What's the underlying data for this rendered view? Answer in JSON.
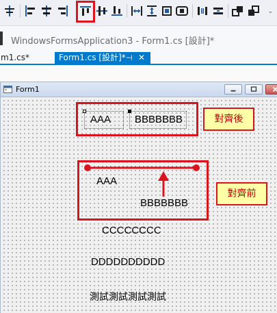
{
  "toolbar": {
    "icons": [
      "align-to-grid-icon",
      "align-lefts-icon",
      "align-centers-icon",
      "align-rights-icon",
      "align-tops-icon",
      "align-middles-icon",
      "align-bottoms-icon",
      "make-same-width-icon",
      "make-same-height-icon",
      "size-to-grid-icon",
      "make-same-size-icon",
      "horizontal-spacing-icon",
      "vertical-spacing-icon",
      "bring-to-front-icon",
      "send-to-back-icon"
    ],
    "highlighted_icon": "align-tops-icon",
    "overflow_glyph": "⌄",
    "accent_color": "#e0141e"
  },
  "title_bar": {
    "text": "WindowsFormsApplication3 - Form1.cs [設計]*"
  },
  "tabs": {
    "inactive_label": "m1.cs*",
    "active_label": "Form1.cs [設計]*",
    "pin_glyph": "⊣",
    "close_glyph": "✕",
    "active_color": "#007acc"
  },
  "form": {
    "title": "Form1",
    "labels": {
      "aaa_after": "AAA",
      "bbb_after": "BBBBBBB",
      "aaa_before": "AAA",
      "bbb_before": "BBBBBBB",
      "ccc": "CCCCCCCC",
      "ddd": "DDDDDDDDDD",
      "test": "測試測試測試測試"
    }
  },
  "annotations": {
    "after_label": "對齊後",
    "before_label": "對齊前",
    "highlight_color": "#d9141e",
    "callout_fill": "#ffffa8"
  }
}
